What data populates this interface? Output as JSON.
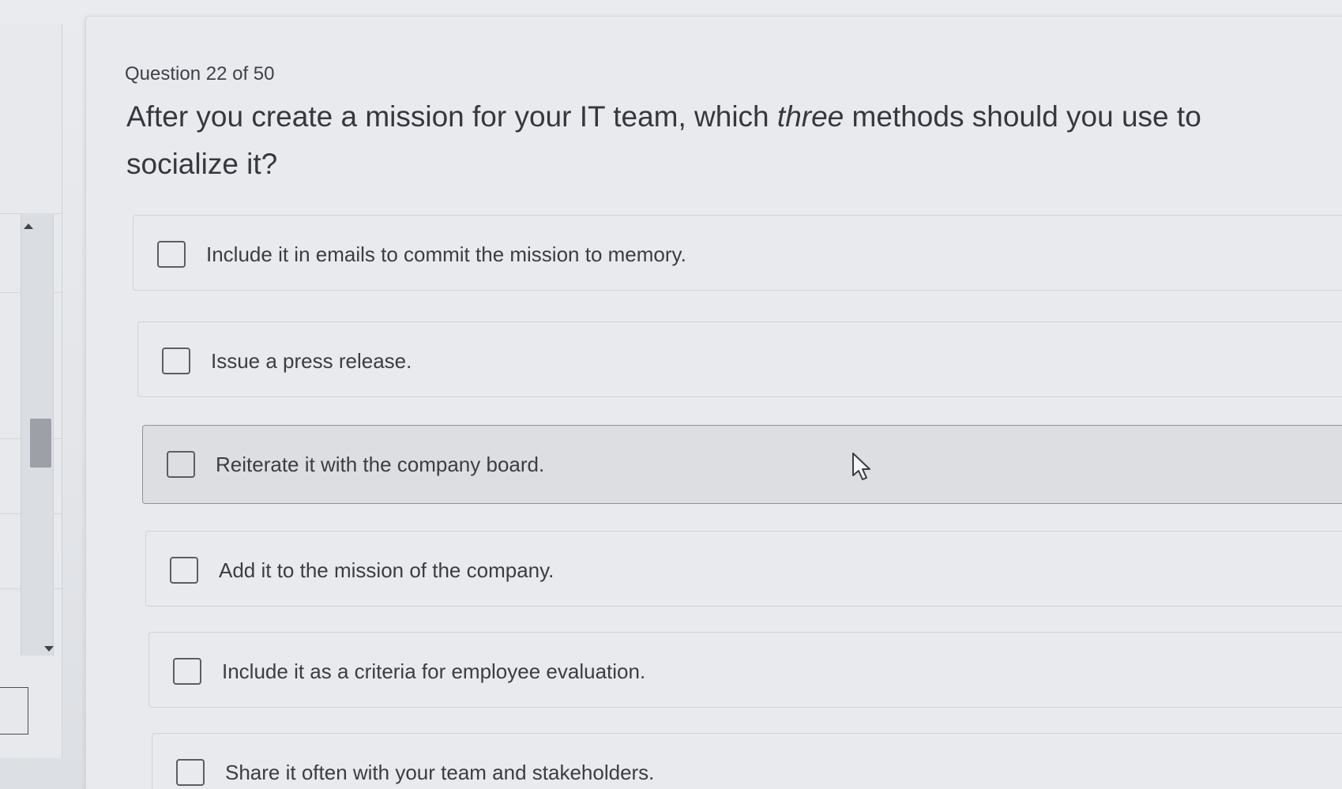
{
  "question": {
    "counter": "Question 22 of 50",
    "text_before": "After you create a mission for your IT team, which ",
    "text_emphasis": "three",
    "text_after": " methods should you use to socialize it?"
  },
  "options": [
    {
      "label": "Include it in emails to commit the mission to memory.",
      "checked": false
    },
    {
      "label": "Issue a press release.",
      "checked": false
    },
    {
      "label": "Reiterate it with the company board.",
      "checked": false
    },
    {
      "label": "Add it to the mission of the company.",
      "checked": false
    },
    {
      "label": "Include it as a criteria for employee evaluation.",
      "checked": false
    },
    {
      "label": "Share it often with your team and stakeholders.",
      "checked": false
    }
  ],
  "icons": {
    "cursor": "mouse-pointer-icon",
    "scroll_up": "triangle-up-icon",
    "scroll_down": "triangle-down-icon"
  },
  "colors": {
    "background": "#e4e6ea",
    "text": "#3a3d42",
    "hover_option": "#dcdee2"
  }
}
